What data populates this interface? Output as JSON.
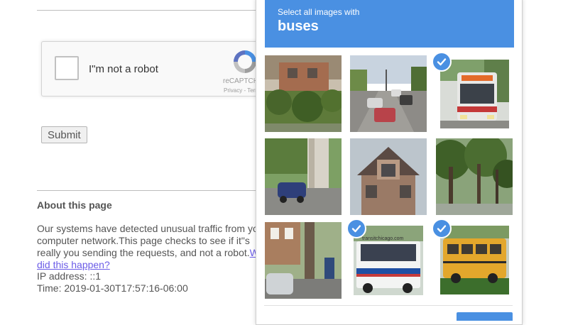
{
  "recaptcha": {
    "label": "I\"m not a robot",
    "brand": "reCAPTCHA",
    "terms": "Privacy - Terms"
  },
  "form": {
    "submit_label": "Submit"
  },
  "about": {
    "title": "About this page",
    "body": "Our systems have detected unusual traffic from your computer network.This page checks to see if it\"s really you sending the requests, and not a robot.",
    "link": "Why did this happen?",
    "ip_line": "IP address: ::1",
    "time_line": "Time: 2019-01-30T17:57:16-06:00"
  },
  "challenge": {
    "instruction": "Select all images with",
    "target": "buses",
    "accent_color": "#4a90e2",
    "tiles": [
      {
        "subject": "building with bushes",
        "selected": false
      },
      {
        "subject": "street with cars",
        "selected": false
      },
      {
        "subject": "bus front",
        "selected": true
      },
      {
        "subject": "parked car and pole",
        "selected": false
      },
      {
        "subject": "house roof",
        "selected": false
      },
      {
        "subject": "trees",
        "selected": false
      },
      {
        "subject": "tree and parked car",
        "selected": false
      },
      {
        "subject": "transit bus",
        "selected": true,
        "text": "transitchicago.com"
      },
      {
        "subject": "school bus",
        "selected": true
      }
    ]
  }
}
